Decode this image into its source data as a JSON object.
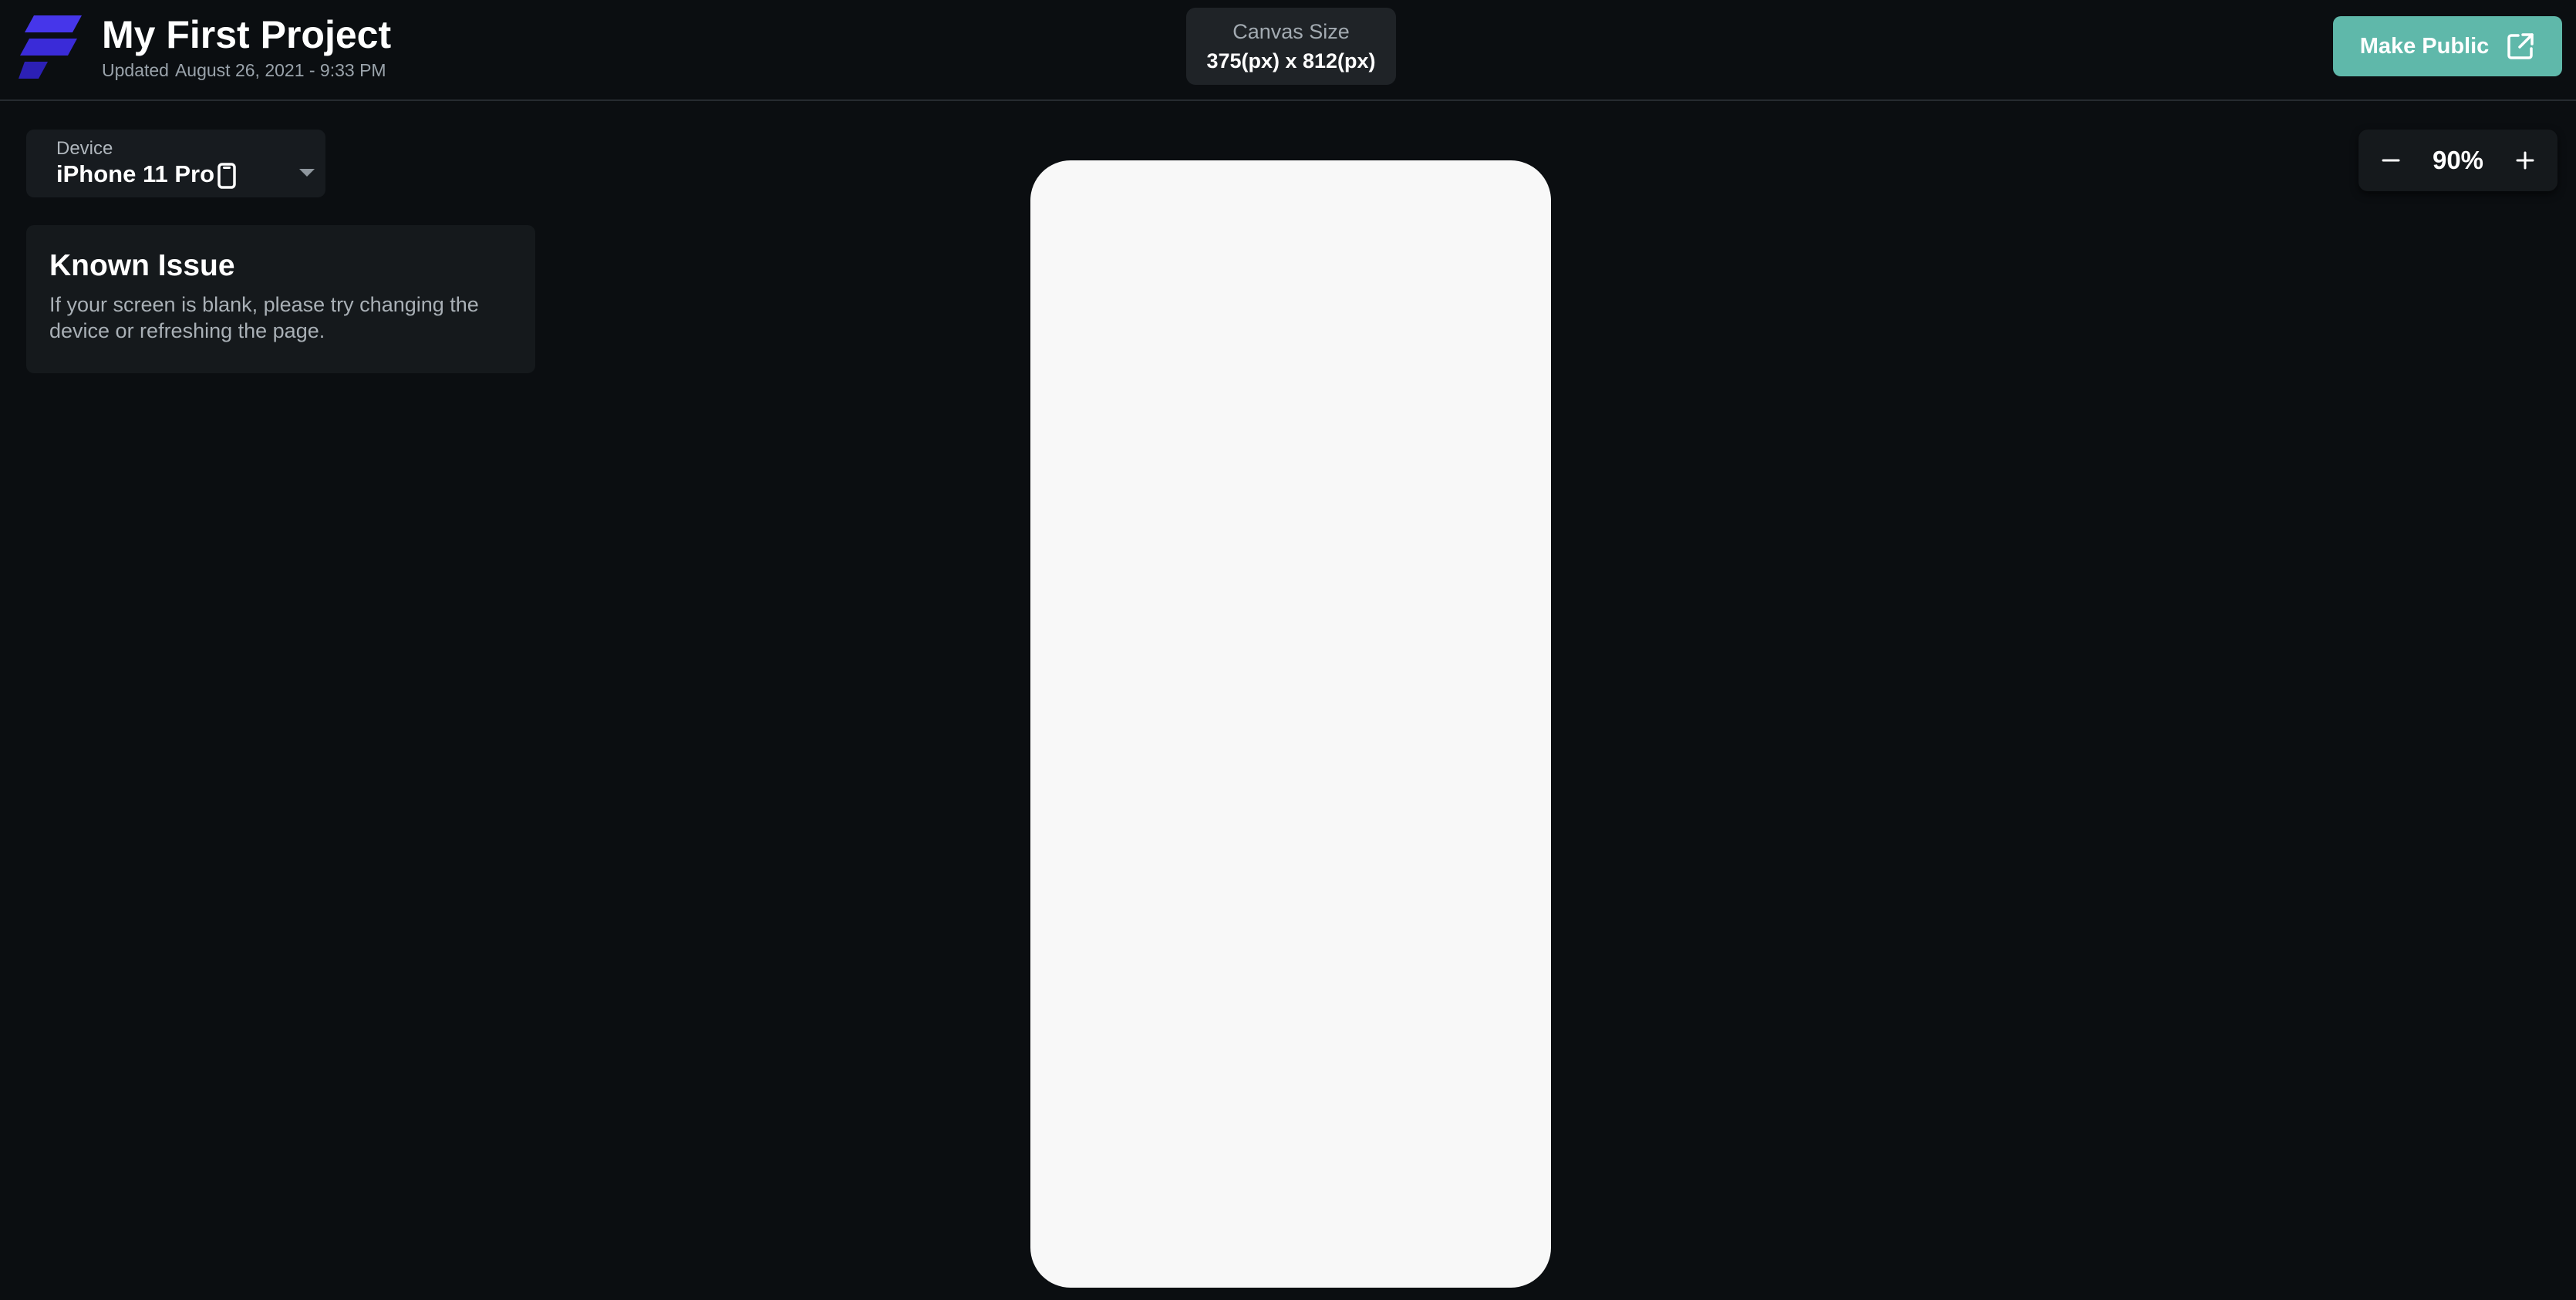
{
  "colors": {
    "background": "#0b0e11",
    "panel": "#171b1f",
    "accent_teal": "#5fb8aa",
    "logo_blue": "#4335e6",
    "logo_blue_dark": "#2a1fb8",
    "canvas": "#f8f8f8"
  },
  "header": {
    "project_title": "My First Project",
    "updated_prefix": "Updated",
    "updated_date": "August 26, 2021 - 9:33 PM",
    "canvas_size": {
      "label": "Canvas Size",
      "value": "375(px) x 812(px)"
    },
    "make_public": {
      "label": "Make Public",
      "icon": "external-link-icon"
    },
    "logo_icon": "app-logo-icon"
  },
  "device_selector": {
    "label": "Device",
    "value": "iPhone 11 Pro",
    "device_icon": "phone-icon",
    "dropdown_icon": "chevron-down-icon"
  },
  "known_issue": {
    "title": "Known Issue",
    "text": "If your screen is blank, please try changing the device or refreshing the page."
  },
  "zoom": {
    "decrease_icon": "minus-icon",
    "value": "90%",
    "increase_icon": "plus-icon"
  }
}
